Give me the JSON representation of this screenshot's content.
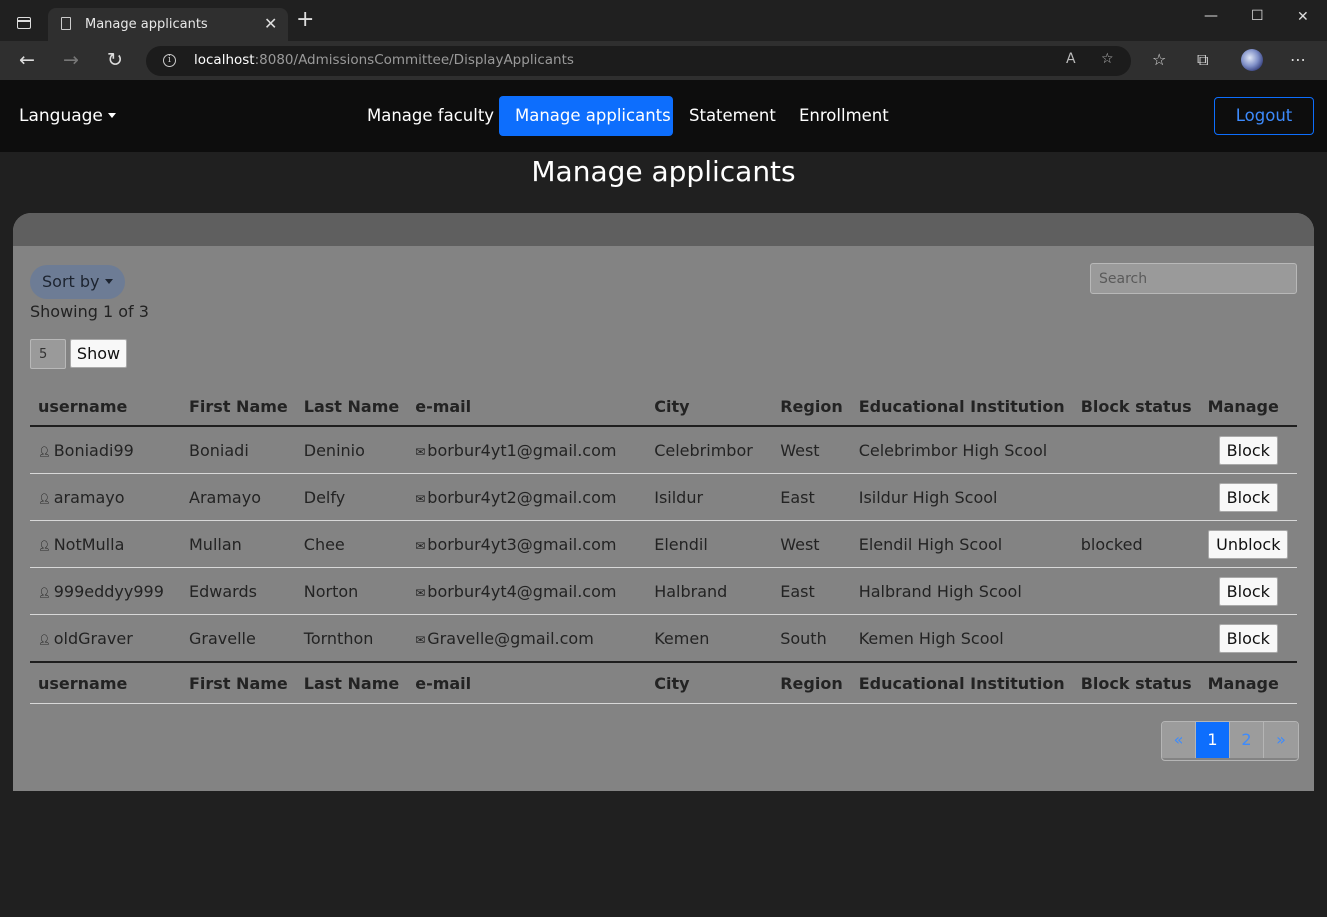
{
  "browser": {
    "tab_title": "Manage applicants",
    "url_host": "localhost",
    "url_rest": ":8080/AdmissionsCommittee/DisplayApplicants"
  },
  "navbar": {
    "language": "Language",
    "links": [
      "Manage faculty",
      "Manage applicants",
      "Statement",
      "Enrollment"
    ],
    "logout": "Logout"
  },
  "page": {
    "title": "Manage applicants"
  },
  "controls": {
    "sort_by": "Sort by",
    "search_placeholder": "Search",
    "showing": "Showing 1 of 3",
    "page_size": "5",
    "show_button": "Show"
  },
  "table": {
    "columns": [
      "username",
      "First Name",
      "Last Name",
      "e-mail",
      "City",
      "Region",
      "Educational Institution",
      "Block status",
      "Manage"
    ],
    "rows": [
      {
        "username": "Boniadi99",
        "first": "Boniadi",
        "last": "Deninio",
        "email": "borbur4yt1@gmail.com",
        "city": "Celebrimbor",
        "region": "West",
        "institution": "Celebrimbor High Scool",
        "status": "",
        "action": "Block"
      },
      {
        "username": "aramayo",
        "first": "Aramayo",
        "last": "Delfy",
        "email": "borbur4yt2@gmail.com",
        "city": "Isildur",
        "region": "East",
        "institution": "Isildur High Scool",
        "status": "",
        "action": "Block"
      },
      {
        "username": "NotMulla",
        "first": "Mullan",
        "last": "Chee",
        "email": "borbur4yt3@gmail.com",
        "city": "Elendil",
        "region": "West",
        "institution": "Elendil High Scool",
        "status": "blocked",
        "action": "Unblock"
      },
      {
        "username": "999eddyy999",
        "first": "Edwards",
        "last": "Norton",
        "email": "borbur4yt4@gmail.com",
        "city": "Halbrand",
        "region": "East",
        "institution": "Halbrand High Scool",
        "status": "",
        "action": "Block"
      },
      {
        "username": "oldGraver",
        "first": "Gravelle",
        "last": "Tornthon",
        "email": "Gravelle@gmail.com",
        "city": "Kemen",
        "region": "South",
        "institution": "Kemen High Scool",
        "status": "",
        "action": "Block"
      }
    ]
  },
  "pagination": {
    "prev": "«",
    "pages": [
      "1",
      "2"
    ],
    "current": "1",
    "next": "»"
  },
  "colors": {
    "accent": "#0d6efd",
    "background": "#202020",
    "card": "#838383"
  }
}
